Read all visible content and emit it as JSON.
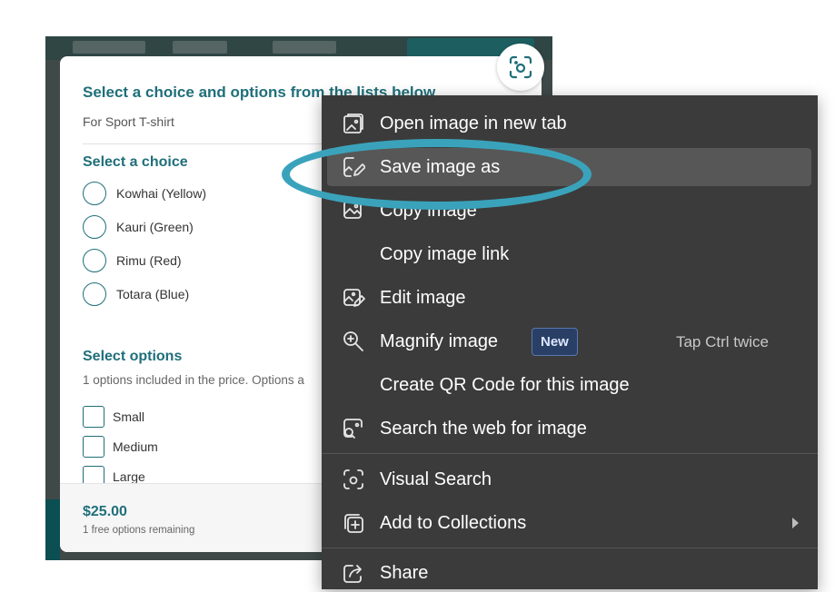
{
  "form": {
    "title": "Select a choice and options from the lists below",
    "subtitle": "For Sport T-shirt",
    "choice_heading": "Select a choice",
    "choices": [
      "Kowhai (Yellow)",
      "Kauri (Green)",
      "Rimu (Red)",
      "Totara (Blue)"
    ],
    "options_heading": "Select options",
    "options_note": "1 options included in the price. Options a",
    "options": [
      "Small",
      "Medium",
      "Large"
    ],
    "price": "$25.00",
    "remaining": "1 free options remaining"
  },
  "context_menu": {
    "items": [
      {
        "label": "Open image in new tab",
        "icon": "open-image-icon"
      },
      {
        "label": "Save image as",
        "icon": "save-image-icon"
      },
      {
        "label": "Copy image",
        "icon": "copy-image-icon"
      },
      {
        "label": "Copy image link",
        "icon": ""
      },
      {
        "label": "Edit image",
        "icon": "edit-image-icon"
      },
      {
        "label": "Magnify image",
        "icon": "magnify-icon",
        "badge": "New",
        "shortcut": "Tap Ctrl twice"
      },
      {
        "label": "Create QR Code for this image",
        "icon": ""
      },
      {
        "label": "Search the web for image",
        "icon": "search-web-image-icon"
      },
      {
        "label": "Visual Search",
        "icon": "visual-search-icon"
      },
      {
        "label": "Add to Collections",
        "icon": "collections-icon"
      },
      {
        "label": "Share",
        "icon": "share-icon"
      }
    ]
  },
  "colors": {
    "accent": "#1f6f7a",
    "highlight_ring": "#3aa3bb",
    "menu_bg": "#3b3b3b",
    "menu_hover": "#575757",
    "badge_bg": "#2a3f66"
  }
}
